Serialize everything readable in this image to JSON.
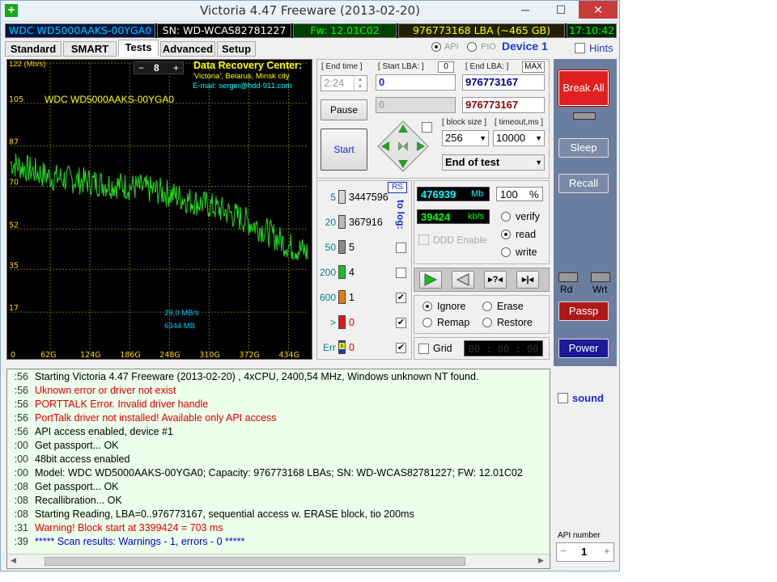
{
  "window": {
    "title": "Victoria 4.47  Freeware (2013-02-20)",
    "controls": {
      "minimize": "─",
      "maximize": "☐",
      "close": "✕"
    }
  },
  "infobar": {
    "model": "WDC WD5000AAKS-00YGA0",
    "serial": "SN: WD-WCAS82781227",
    "firmware": "Fw: 12.01C02",
    "lba": "976773168 LBA (~465 GB)",
    "time": "17:10:42"
  },
  "tabs": [
    "Standard",
    "SMART",
    "Tests",
    "Advanced",
    "Setup"
  ],
  "mode": {
    "api": "API",
    "pio": "PIO",
    "device": "Device 1",
    "hints": "Hints"
  },
  "graph": {
    "unit": "(Mb/s)",
    "zoom": "8",
    "zoom_minus": "−",
    "zoom_plus": "+",
    "credit_title": "Data Recovery Center:",
    "credit_line1": "'Victoria', Belarus, Minsk city",
    "credit_line2": "E-mail: sergei@hdd-911.com",
    "drive_label": "WDC WD5000AAKS-00YGA0",
    "speed_readout": "29,0 MB/s",
    "mb_readout": "6344 MB"
  },
  "chart_data": {
    "type": "line",
    "ylim": [
      0,
      122
    ],
    "yticks": [
      "122",
      "105",
      "87",
      "70",
      "52",
      "35",
      "17"
    ],
    "xticks": [
      "0",
      "62G",
      "124G",
      "186G",
      "248G",
      "310G",
      "372G",
      "434G"
    ],
    "series": [
      {
        "x_gb": [
          0,
          20,
          40,
          62,
          90,
          124,
          150,
          186,
          210,
          248,
          280,
          310,
          340,
          372,
          400,
          434,
          465
        ],
        "values": [
          80,
          78,
          76,
          74,
          73,
          72,
          71,
          70,
          69,
          67,
          64,
          62,
          59,
          55,
          51,
          45,
          42
        ]
      }
    ],
    "line_color": "#22dd22"
  },
  "lba": {
    "end_time_label": "[ End time ]",
    "end_time": "2:24",
    "start_label": "[ Start LBA: ]",
    "start_badge": "0",
    "start_value": "0",
    "end_label": "[ End LBA: ]",
    "max_label": "MAX",
    "end_value": "976773167",
    "current": "0",
    "current_end": "976773167"
  },
  "buttons": {
    "pause": "Pause",
    "start": "Start",
    "break_all": "Break All",
    "sleep": "Sleep",
    "recall": "Recall",
    "passp": "Passp",
    "power": "Power"
  },
  "block": {
    "size_label": "[ block size ]",
    "size": "256",
    "timeout_label": "[ timeout,ms ]",
    "timeout": "10000",
    "end_action": "End of test"
  },
  "latency": {
    "rs": "RS",
    "to_log": "to log:",
    "rows": [
      {
        "ms": "5",
        "count": "3447596",
        "color": "#d8d8d8"
      },
      {
        "ms": "20",
        "count": "367916",
        "color": "#b8b8b8"
      },
      {
        "ms": "50",
        "count": "5",
        "color": "#888888"
      },
      {
        "ms": "200",
        "count": "4",
        "color": "#22bb22"
      },
      {
        "ms": "600",
        "count": "1",
        "color": "#ee7700"
      },
      {
        "ms": ">",
        "count": "0",
        "color": "#ee1111"
      },
      {
        "ms": "Err",
        "count": "0",
        "color": "#2233cc"
      }
    ]
  },
  "stats": {
    "mb": "476939",
    "mb_unit": "Mb",
    "percent": "100",
    "percent_unit": "%",
    "speed": "39424",
    "speed_unit": "kb/s",
    "ddd": "DDD Enable"
  },
  "scan_mode": {
    "verify": "verify",
    "read": "read",
    "write": "write",
    "selected": "read"
  },
  "action": {
    "ignore": "Ignore",
    "erase": "Erase",
    "remap": "Remap",
    "restore": "Restore",
    "selected": "Ignore"
  },
  "grid": {
    "label": "Grid",
    "timer": "00 : 00 : 00"
  },
  "side": {
    "rd": "Rd",
    "wrt": "Wrt",
    "sound": "sound",
    "api_number_label": "API number",
    "api_number": "1",
    "minus": "−",
    "plus": "+"
  },
  "log": [
    {
      "ts": ":56",
      "text": "Starting Victoria 4.47  Freeware (2013-02-20) , 4xCPU, 2400,54 MHz, Windows unknown NT found.",
      "color": "#000000"
    },
    {
      "ts": ":56",
      "text": "Uknown error or driver not exist",
      "color": "#dd0000"
    },
    {
      "ts": ":56",
      "text": "PORTTALK Error. Invalid driver handle",
      "color": "#dd0000"
    },
    {
      "ts": ":56",
      "text": "PortTalk driver not installed! Available only API access",
      "color": "#dd0000"
    },
    {
      "ts": ":56",
      "text": "API access enabled, device #1",
      "color": "#000000"
    },
    {
      "ts": ":00",
      "text": "Get passport... OK",
      "color": "#000000"
    },
    {
      "ts": ":00",
      "text": "48bit access enabled",
      "color": "#000000"
    },
    {
      "ts": ":00",
      "text": "Model: WDC WD5000AAKS-00YGA0; Capacity: 976773168 LBAs; SN: WD-WCAS82781227; FW: 12.01C02",
      "color": "#000000"
    },
    {
      "ts": ":08",
      "text": "Get passport... OK",
      "color": "#000000"
    },
    {
      "ts": ":08",
      "text": "Recallibration... OK",
      "color": "#000000"
    },
    {
      "ts": ":08",
      "text": "Starting Reading, LBA=0..976773167, sequential access w. ERASE block, tio 200ms",
      "color": "#000000"
    },
    {
      "ts": ":31",
      "text": "Warning! Block start at 3399424 = 703 ms",
      "color": "#dd0000"
    },
    {
      "ts": ":39",
      "text": "***** Scan results: Warnings - 1, errors - 0 *****",
      "color": "#0000cc"
    }
  ]
}
